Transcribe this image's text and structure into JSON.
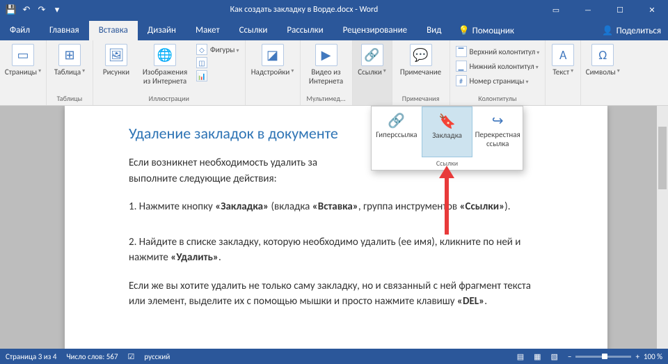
{
  "title": "Как создать закладку в Ворде.docx  -  Word",
  "qat": {
    "save": "💾",
    "undo": "↶",
    "redo": "↷"
  },
  "win": {
    "ribbon": "▭",
    "min": "—",
    "max": "☐",
    "close": "✕"
  },
  "tabs": [
    "Файл",
    "Главная",
    "Вставка",
    "Дизайн",
    "Макет",
    "Ссылки",
    "Рассылки",
    "Рецензирование",
    "Вид"
  ],
  "active_tab": 2,
  "assistant": "Помощник",
  "share": "Поделиться",
  "groups": {
    "pages": {
      "label": "",
      "btn": "Страницы"
    },
    "tables": {
      "label": "Таблицы",
      "btn": "Таблица"
    },
    "illus": {
      "label": "Иллюстрации",
      "pic": "Рисунки",
      "online": "Изображения из Интернета",
      "shapes": "Фигуры",
      "smartart": "",
      "chart": ""
    },
    "addins": {
      "label": "",
      "btn": "Надстройки"
    },
    "media": {
      "label": "Мультимед...",
      "btn": "Видео из Интернета"
    },
    "links": {
      "label": "",
      "btn": "Ссылки"
    },
    "comments": {
      "label": "Примечания",
      "btn": "Примечание"
    },
    "headers": {
      "label": "Колонтитулы",
      "top": "Верхний колонтитул",
      "bottom": "Нижний колонтитул",
      "page": "Номер страницы"
    },
    "text": {
      "label": "",
      "btn": "Текст"
    },
    "symbols": {
      "label": "",
      "btn": "Символы"
    }
  },
  "popover": {
    "hyperlink": "Гиперссылка",
    "bookmark": "Закладка",
    "crossref": "Перекрестная ссылка",
    "label": "Ссылки"
  },
  "doc": {
    "heading": "Удаление закладок в документе",
    "p1a": "Если возникнет необходимость удалить за",
    "p1b": "выполните следующие действия:",
    "p2a": "1. Нажмите кнопку ",
    "p2b": "«Закладка»",
    "p2c": " (вкладка ",
    "p2d": "«Вставка»",
    "p2e": ", группа инструментов ",
    "p2f": "«Ссылки»",
    "p2g": ").",
    "p3a": "2. Найдите в списке закладку, которую необходимо удалить (ее имя), кликните по ней и нажмите ",
    "p3b": "«Удалить»",
    "p3c": ".",
    "p4a": "Если же вы хотите удалить не только саму закладку, но и связанный с ней фрагмент текста или элемент, выделите их с помощью мышки и просто нажмите клавишу ",
    "p4b": "«DEL»",
    "p4c": "."
  },
  "status": {
    "page": "Страница 3 из 4",
    "words": "Число слов: 567",
    "lang": "русский",
    "zoom": "100 %"
  }
}
